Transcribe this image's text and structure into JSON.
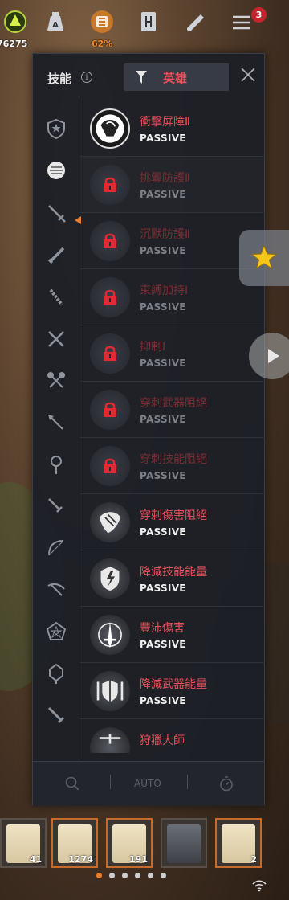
{
  "topbar": {
    "gold_count": "76275",
    "weight_percent": "62%",
    "menu_badge": "3",
    "colors": {
      "weight": "#f08a2c",
      "badge": "#c4242c"
    }
  },
  "panel": {
    "title": "技能",
    "filter_label": "英雄",
    "close_icon": "close-icon",
    "info_icon": "i",
    "accent": "#e8505a"
  },
  "categories": [
    {
      "icon": "shield-star-icon"
    },
    {
      "icon": "crystal-orb-icon",
      "selected": true
    },
    {
      "icon": "sword-icon"
    },
    {
      "icon": "greatsword-icon"
    },
    {
      "icon": "mace-icon"
    },
    {
      "icon": "dual-swords-icon"
    },
    {
      "icon": "crossed-axes-icon"
    },
    {
      "icon": "spear-icon"
    },
    {
      "icon": "staff-icon"
    },
    {
      "icon": "dagger-icon"
    },
    {
      "icon": "bow-icon"
    },
    {
      "icon": "crossbow-icon"
    },
    {
      "icon": "pentagram-icon"
    },
    {
      "icon": "orb-staff-icon"
    },
    {
      "icon": "blade-icon"
    }
  ],
  "skills": [
    {
      "name": "衝擊屏障Ⅱ",
      "type": "PASSIVE",
      "locked": false,
      "icon": "shield-horn-icon"
    },
    {
      "name": "挑釁防護Ⅱ",
      "type": "PASSIVE",
      "locked": true,
      "icon": "lock-icon"
    },
    {
      "name": "沉默防護Ⅱ",
      "type": "PASSIVE",
      "locked": true,
      "icon": "lock-icon"
    },
    {
      "name": "束縛加持Ⅰ",
      "type": "PASSIVE",
      "locked": true,
      "icon": "lock-icon"
    },
    {
      "name": "抑制Ⅰ",
      "type": "PASSIVE",
      "locked": true,
      "icon": "lock-icon"
    },
    {
      "name": "穿刺武器阻絕",
      "type": "PASSIVE",
      "locked": true,
      "icon": "lock-icon"
    },
    {
      "name": "穿刺技能阻絕",
      "type": "PASSIVE",
      "locked": true,
      "icon": "lock-icon"
    },
    {
      "name": "穿刺傷害阻絕",
      "type": "PASSIVE",
      "locked": false,
      "icon": "dragon-shield-icon"
    },
    {
      "name": "降減技能能量",
      "type": "PASSIVE",
      "locked": false,
      "icon": "lightning-shield-icon"
    },
    {
      "name": "豐沛傷害",
      "type": "PASSIVE",
      "locked": false,
      "icon": "sword-aura-icon"
    },
    {
      "name": "降減武器能量",
      "type": "PASSIVE",
      "locked": false,
      "icon": "shield-swords-icon"
    },
    {
      "name": "狩獵大師",
      "type": "",
      "locked": false,
      "icon": "hunter-icon"
    }
  ],
  "footer": {
    "auto_label": "AUTO",
    "zoom_icon": "magnifier-icon",
    "stopwatch_icon": "stopwatch-icon"
  },
  "quickbar": {
    "slots": [
      {
        "count": "41",
        "icon": "scroll-horn-icon",
        "active": false
      },
      {
        "count": "1274",
        "icon": "scroll-pentagon-icon",
        "active": true
      },
      {
        "count": "191",
        "icon": "scroll-warrior-icon",
        "active": true
      },
      {
        "count": "",
        "icon": "rune-tablet-icon",
        "active": false
      },
      {
        "count": "2",
        "icon": "scroll-beast-icon",
        "active": true
      }
    ],
    "page_dots": 6,
    "active_dot": 0
  }
}
